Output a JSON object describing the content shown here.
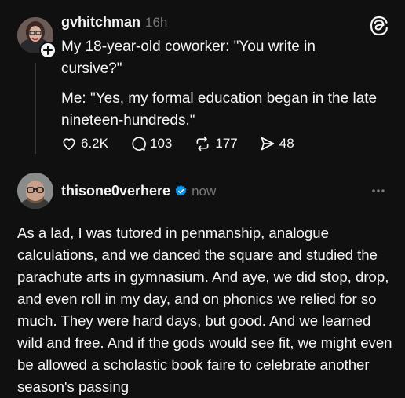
{
  "post1": {
    "username": "gvhitchman",
    "time": "16h",
    "paragraph1": "My 18-year-old coworker: \"You write in cursive?\"",
    "paragraph2": "Me: \"Yes, my formal education began in the late nineteen-hundreds.\"",
    "likes": "6.2K",
    "replies": "103",
    "reposts": "177",
    "shares": "48"
  },
  "post2": {
    "username": "thisone0verhere",
    "time": "now",
    "body": "As a lad, I was tutored in penmanship, analogue calculations, and we danced the square and studied the parachute arts in gymnasium. And aye, we did stop, drop, and even roll in my day, and on phonics we relied for so much. They were hard days, but good. And we learned wild and free. And if the gods would see fit, we might even be allowed a scholastic book faire to celebrate another season's passing"
  },
  "colors": {
    "background": "#101010",
    "text": "#f3f5f7",
    "muted": "#777777",
    "verified": "#0095f6"
  },
  "icons": [
    "threads-logo-icon",
    "follow-plus-icon",
    "heart-icon",
    "comment-icon",
    "repost-icon",
    "share-icon",
    "verified-badge-icon",
    "more-options-icon"
  ]
}
